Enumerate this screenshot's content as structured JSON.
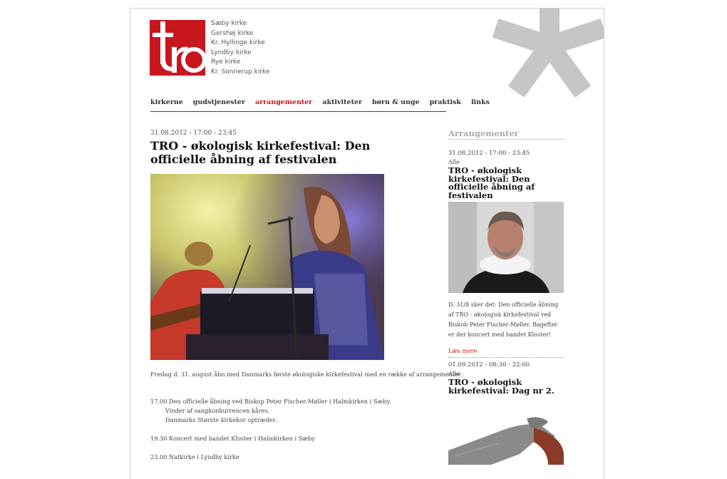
{
  "colors": {
    "brand_red": "#c8161d",
    "asterisk_gray": "#c6c6c6",
    "accent_link": "#c8161d"
  },
  "logo": {
    "text": "tro"
  },
  "churches": [
    "Sæby kirke",
    "Gershøj kirke",
    "Kr. Hyllinge kirke",
    "Lyndby kirke",
    "Rye kirke",
    "Kr. Sonnerup kirke"
  ],
  "nav": {
    "items": [
      "kirkerne",
      "gudstjenester",
      "arrangementer",
      "aktiviteter",
      "børn & unge",
      "praktisk",
      "links"
    ],
    "active": "arrangementer"
  },
  "article": {
    "date": "31.08.2012 - 17:00 - 23:45",
    "title": "TRO - økologisk kirkefestival: Den officielle åbning af festivalen",
    "intro": "Fredag d. 31. august åbn med Danmarks første økologiske kirkefestival med en række af arrangementer:",
    "program": [
      {
        "text": "17.00 Den officielle åbning ved Biskop Peter Fischer-Møller i Halmkirken i Sæby.",
        "indent": false
      },
      {
        "text": "Vinder af sangkonkurrencen kåres.",
        "indent": true
      },
      {
        "text": "Danmarks Største kirkekor optræder.",
        "indent": true
      },
      {
        "text": "",
        "indent": false
      },
      {
        "text": "19.30 Koncert med bandet Kloster i Halmkirken i Sæby",
        "indent": false
      },
      {
        "text": "",
        "indent": false
      },
      {
        "text": "23.00 Natkirke i Lyndby kirke",
        "indent": false
      }
    ]
  },
  "sidebar": {
    "heading": "Arrangementer",
    "events": [
      {
        "date": "31.08.2012 - 17:00 - 23:45",
        "category": "Alle",
        "title": "TRO - økologisk kirkefestival: Den officielle åbning af festivalen",
        "description": "D. 31/8 sker det: Den officielle åbning af TRO - økologisk kirkefestival ved Biskob Peter Fischer-Møller. Bagefter er der koncert med bandet Kloster!",
        "read_more": "Læs mere"
      },
      {
        "date": "01.09.2012 - 08:30 - 22:00",
        "category": "Alle",
        "title": "TRO - økologisk kirkefestival: Dag nr 2."
      }
    ]
  }
}
